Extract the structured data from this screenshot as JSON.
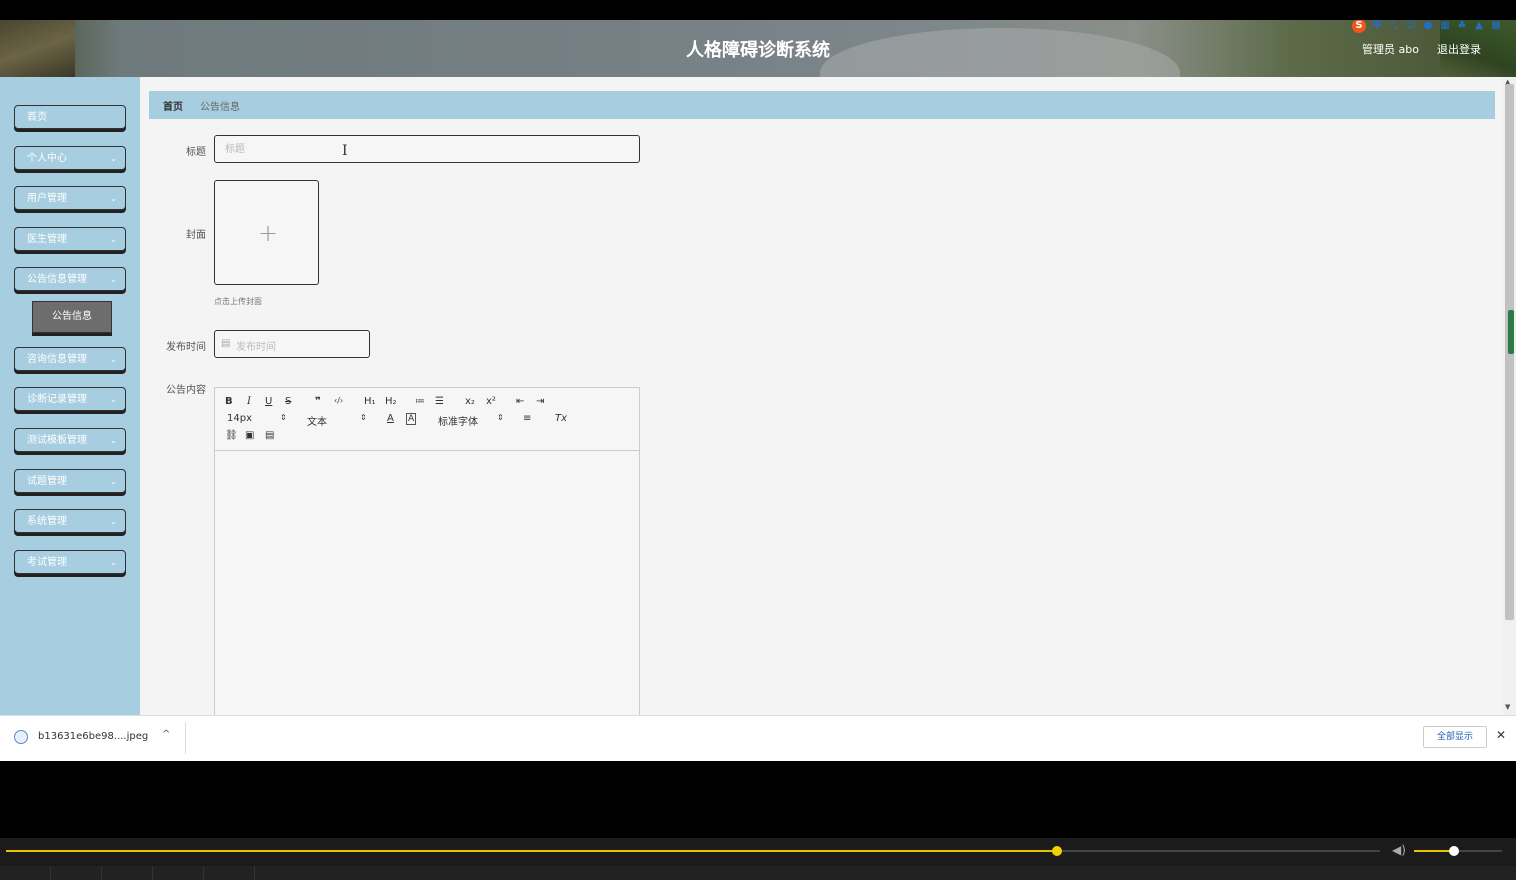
{
  "header": {
    "title": "人格障碍诊断系统",
    "admin_label": "管理员 abo",
    "logout": "退出登录",
    "ime_icons": [
      "sogou-logo",
      "中",
      "°,",
      "☺",
      "mic",
      "keyboard",
      "shirt",
      "skin",
      "grid"
    ]
  },
  "sidebar": {
    "items": [
      {
        "label": "首页",
        "has_chevron": false
      },
      {
        "label": "个人中心",
        "has_chevron": true
      },
      {
        "label": "用户管理",
        "has_chevron": true
      },
      {
        "label": "医生管理",
        "has_chevron": true
      },
      {
        "label": "公告信息管理",
        "has_chevron": true
      },
      {
        "label": "咨询信息管理",
        "has_chevron": true
      },
      {
        "label": "诊断记录管理",
        "has_chevron": true
      },
      {
        "label": "测试模板管理",
        "has_chevron": true
      },
      {
        "label": "试题管理",
        "has_chevron": true
      },
      {
        "label": "系统管理",
        "has_chevron": true
      },
      {
        "label": "考试管理",
        "has_chevron": true
      }
    ],
    "active_sub_item": "公告信息",
    "chevron": "⌄"
  },
  "breadcrumb": {
    "home": "首页",
    "current": "公告信息"
  },
  "form": {
    "title_label": "标题",
    "title_placeholder": "标题",
    "cover_label": "封面",
    "upload_plus": "+",
    "upload_hint": "点击上传封面",
    "publish_time_label": "发布时间",
    "publish_time_placeholder": "发布时间",
    "content_label": "公告内容"
  },
  "editor": {
    "toolbar_row1": [
      "B",
      "I",
      "U",
      "S",
      "❞",
      "‹/›",
      "H₁",
      "H₂",
      "≔",
      "☰",
      "x₂",
      "x²",
      "⇤",
      "⇥"
    ],
    "font_size": "14px",
    "text_type": "文本",
    "font_family": "标准字体",
    "row2_icons": [
      "A",
      "A̲",
      "≡",
      "Tx"
    ],
    "row3_icons": [
      "link",
      "image",
      "video"
    ]
  },
  "download_bar": {
    "file_name": "b13631e6be98....jpeg",
    "show_all": "全部显示",
    "close": "✕"
  },
  "player": {
    "progress": 0.765,
    "volume": 0.45
  },
  "colors": {
    "sidebar_bg": "#a7cde0",
    "main_bg": "#f4f4f4",
    "active_sub_bg": "#6d6d6d",
    "progress": "#e8c400"
  }
}
